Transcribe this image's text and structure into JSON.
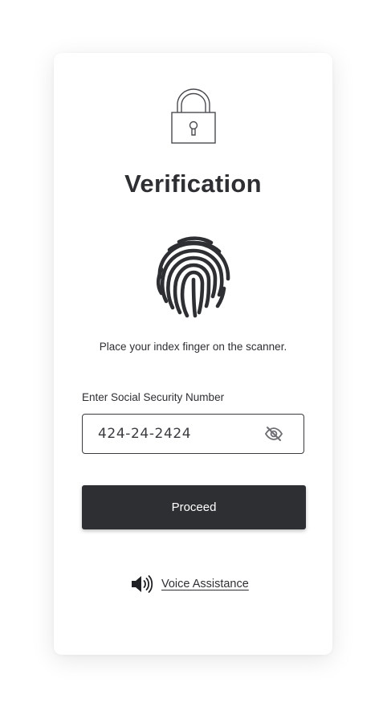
{
  "icons": {
    "lock": "lock-icon",
    "fingerprint": "fingerprint-icon",
    "eye": "eye-off-icon",
    "speaker": "speaker-icon"
  },
  "colors": {
    "primary": "#2e2f33",
    "background": "#ffffff",
    "button_text": "#ffffff"
  },
  "title": "Verification",
  "instruction": "Place your index finger on the scanner.",
  "ssn_field": {
    "label": "Enter Social Security Number",
    "value": "424-24-2424"
  },
  "proceed_label": "Proceed",
  "voice_assistance_label": "Voice Assistance"
}
